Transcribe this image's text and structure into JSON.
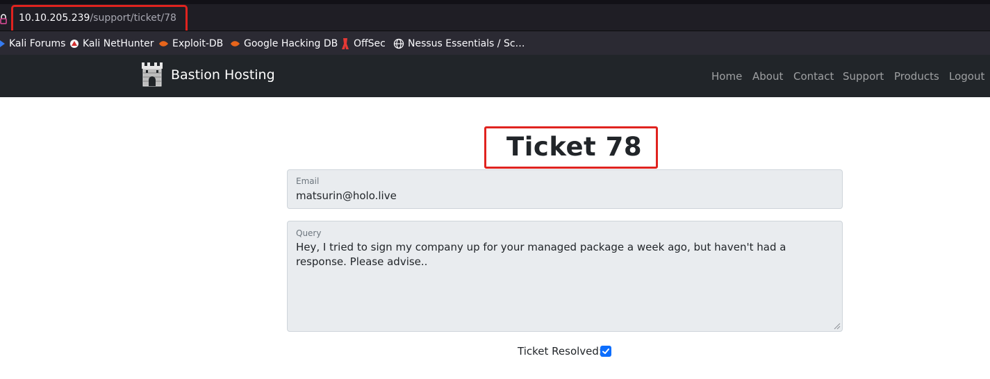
{
  "browser": {
    "url_host": "10.10.205.239",
    "url_path": "/support/ticket/78",
    "bookmarks": [
      {
        "label": "Kali Forums",
        "icon": "kali-icon"
      },
      {
        "label": "Kali NetHunter",
        "icon": "nethunter-icon"
      },
      {
        "label": "Exploit-DB",
        "icon": "exploitdb-icon"
      },
      {
        "label": "Google Hacking DB",
        "icon": "ghdb-icon"
      },
      {
        "label": "OffSec",
        "icon": "offsec-icon"
      },
      {
        "label": "Nessus Essentials / Sc…",
        "icon": "globe-icon"
      }
    ]
  },
  "site": {
    "brand": "Bastion Hosting",
    "nav": [
      "Home",
      "About",
      "Contact",
      "Support",
      "Products",
      "Logout"
    ]
  },
  "ticket": {
    "title": "Ticket 78",
    "email_label": "Email",
    "email_value": "matsurin@holo.live",
    "query_label": "Query",
    "query_value": "Hey, I tried to sign my company up for your managed package a week ago, but haven't had a response. Please advise..",
    "resolved_label": "Ticket Resolved:",
    "resolved": true
  },
  "colors": {
    "highlight": "#e0231f",
    "navbar": "#212529",
    "checkbox": "#0d6efd"
  }
}
